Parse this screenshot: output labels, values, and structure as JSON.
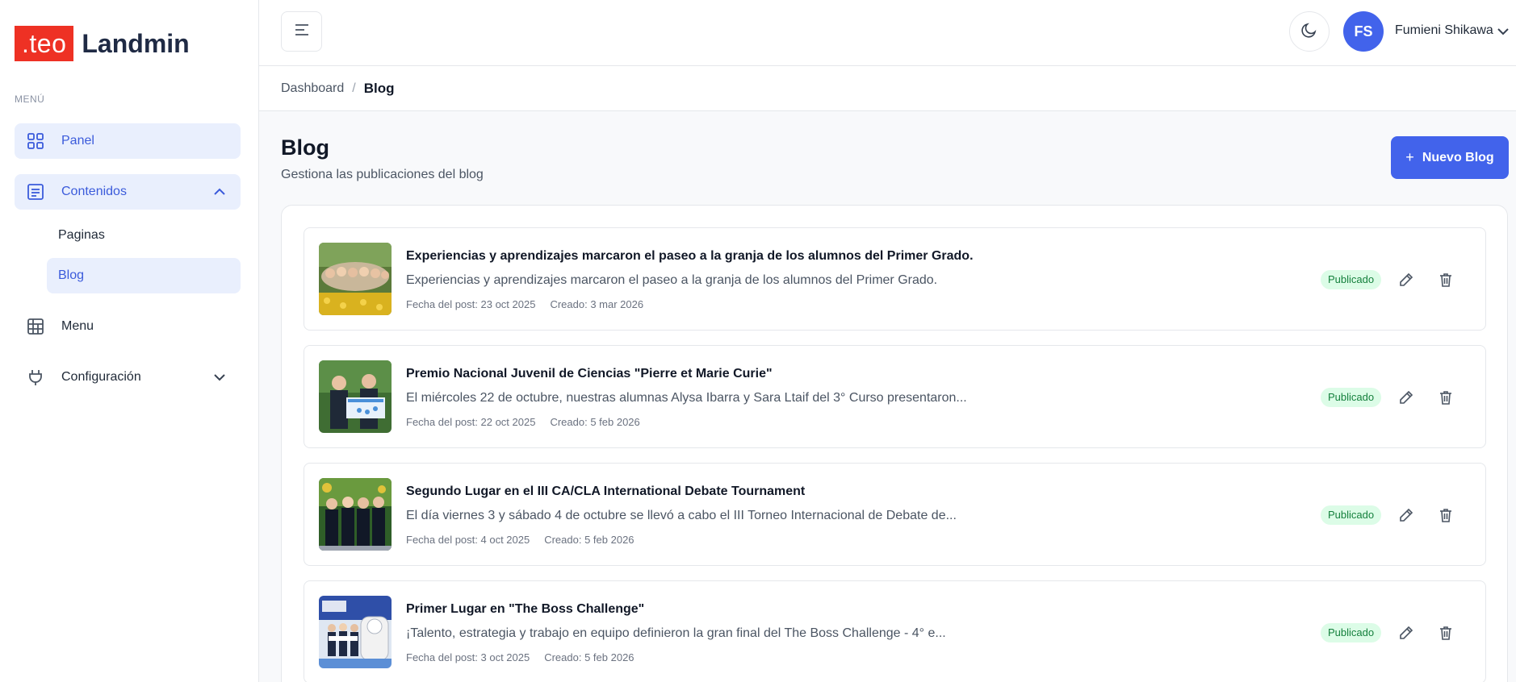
{
  "brand": {
    "badge": ".teo",
    "name": "Landmin",
    "badge_color": "#ee3124"
  },
  "sidebar": {
    "section_label": "MENÚ",
    "items": [
      {
        "label": "Panel",
        "icon": "grid-icon",
        "active": true
      },
      {
        "label": "Contenidos",
        "icon": "document-icon",
        "expanded": true,
        "children": [
          {
            "label": "Paginas"
          },
          {
            "label": "Blog",
            "active": true
          }
        ]
      },
      {
        "label": "Menu",
        "icon": "table-icon"
      },
      {
        "label": "Configuración",
        "icon": "plug-icon"
      }
    ]
  },
  "topbar": {
    "menu_toggle_icon": "hamburger-icon",
    "theme_icon": "moon-icon",
    "user": {
      "initials": "FS",
      "name": "Fumieni Shikawa"
    }
  },
  "breadcrumb": {
    "parent": "Dashboard",
    "separator": "/",
    "current": "Blog"
  },
  "page": {
    "title": "Blog",
    "subtitle": "Gestiona las publicaciones del blog",
    "new_button": "Nuevo Blog",
    "new_button_symbol": "+"
  },
  "posts": [
    {
      "title": "Experiencias y aprendizajes marcaron el paseo a la granja de los alumnos del Primer Grado.",
      "excerpt": "Experiencias y aprendizajes marcaron el paseo a la granja de los alumnos del Primer Grado.",
      "post_date": "Fecha del post: 23 oct 2025",
      "created": "Creado: 3 mar 2026",
      "status": "Publicado"
    },
    {
      "title": "Premio Nacional Juvenil de Ciencias \"Pierre et Marie Curie\"",
      "excerpt": "El miércoles 22 de octubre, nuestras alumnas Alysa Ibarra y Sara Ltaif del 3° Curso presentaron...",
      "post_date": "Fecha del post: 22 oct 2025",
      "created": "Creado: 5 feb 2026",
      "status": "Publicado"
    },
    {
      "title": "Segundo Lugar en el III CA/CLA International Debate Tournament",
      "excerpt": "El día viernes 3 y sábado 4 de octubre se llevó a cabo el III Torneo Internacional de Debate de...",
      "post_date": "Fecha del post: 4 oct 2025",
      "created": "Creado: 5 feb 2026",
      "status": "Publicado"
    },
    {
      "title": "Primer Lugar en \"The Boss Challenge\"",
      "excerpt": "¡Talento, estrategia y trabajo en equipo definieron la gran final del The Boss Challenge - 4° e...",
      "post_date": "Fecha del post: 3 oct 2025",
      "created": "Creado: 5 feb 2026",
      "status": "Publicado"
    }
  ],
  "colors": {
    "accent": "#4263eb",
    "active_bg": "#e9effd",
    "status_bg": "#dcfce7",
    "status_text": "#15803d"
  }
}
